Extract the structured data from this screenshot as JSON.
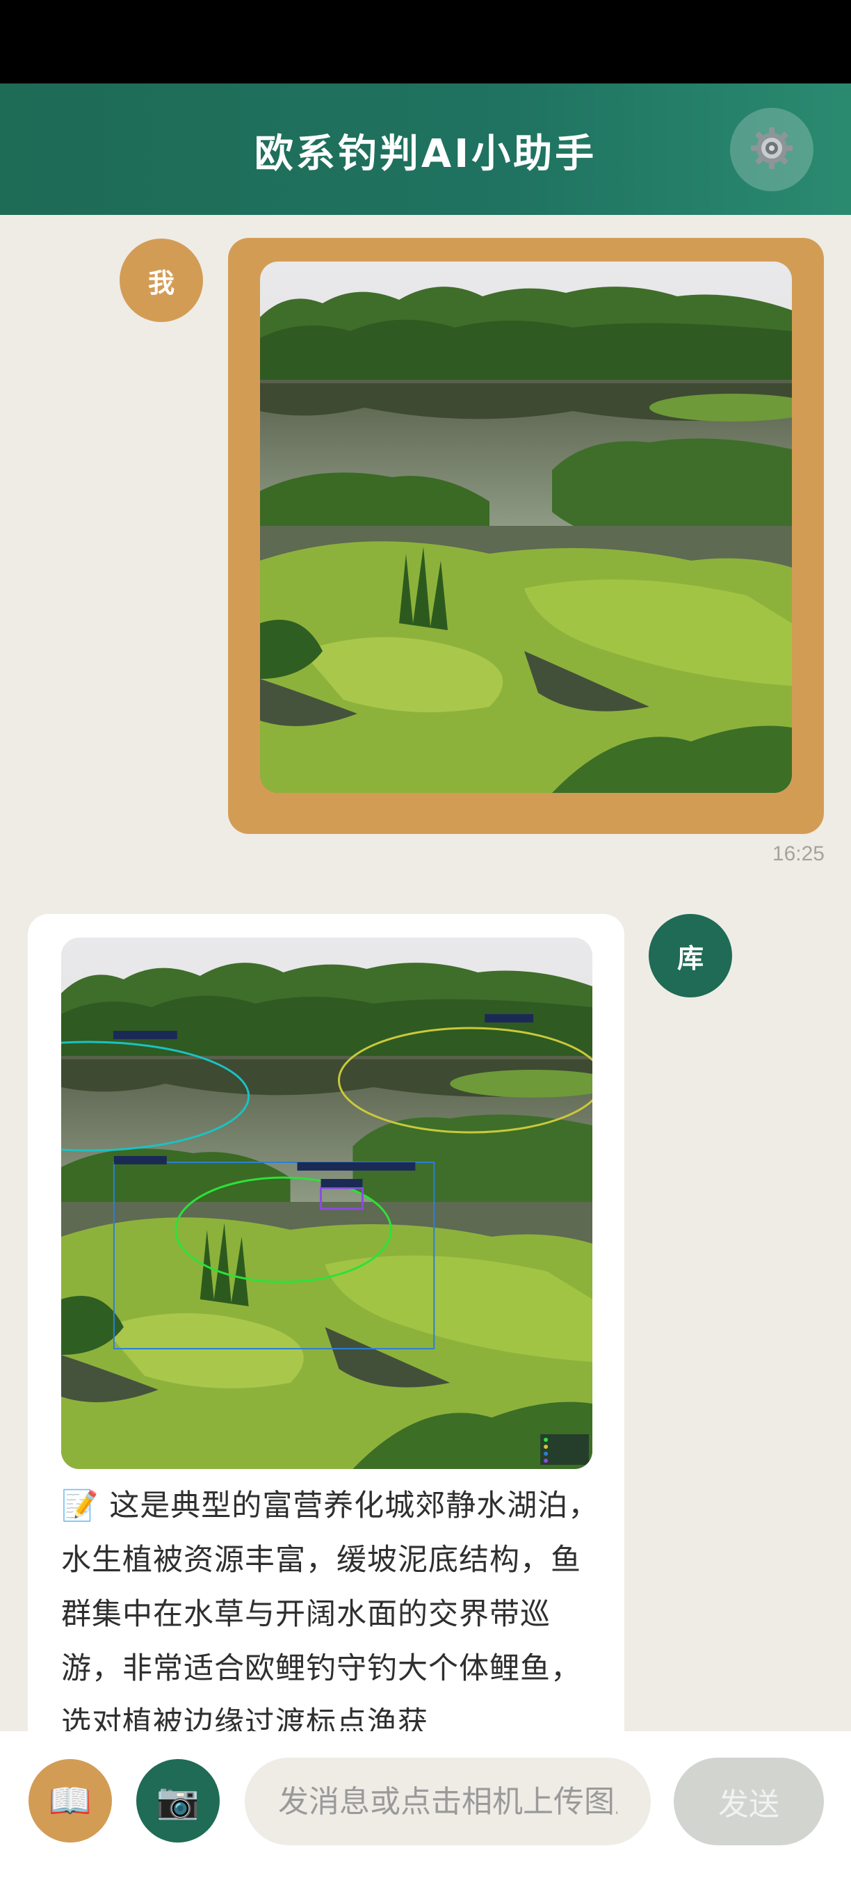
{
  "header": {
    "title": "欧系钓判AI小助手",
    "settings_icon": "gear-icon"
  },
  "messages": [
    {
      "role": "user",
      "avatar_label": "我",
      "content": "photo",
      "time": "16:25"
    },
    {
      "role": "assistant",
      "avatar_label": "库",
      "content": "annotated-photo",
      "reply_icon": "memo-icon",
      "reply_emoji": "📝",
      "reply_text": "这是典型的富营养化城郊静水湖泊，水生植被资源丰富，缓坡泥底结构，鱼群集中在水草与开阔水面的交界带巡游，非常适合欧鲤钓守钓大个体鲤鱼，选对植被边缘过渡标点渔获"
    }
  ],
  "input_bar": {
    "book_icon": "book-icon",
    "book_emoji": "📖",
    "camera_icon": "camera-icon",
    "camera_emoji": "📷",
    "placeholder": "发消息或点击相机上传图片",
    "send_label": "发送"
  },
  "colors": {
    "header_bg": "#1F6B55",
    "accent_gold": "#D39C55",
    "page_bg": "#EFECE6",
    "send_disabled": "#D2D4D0"
  }
}
